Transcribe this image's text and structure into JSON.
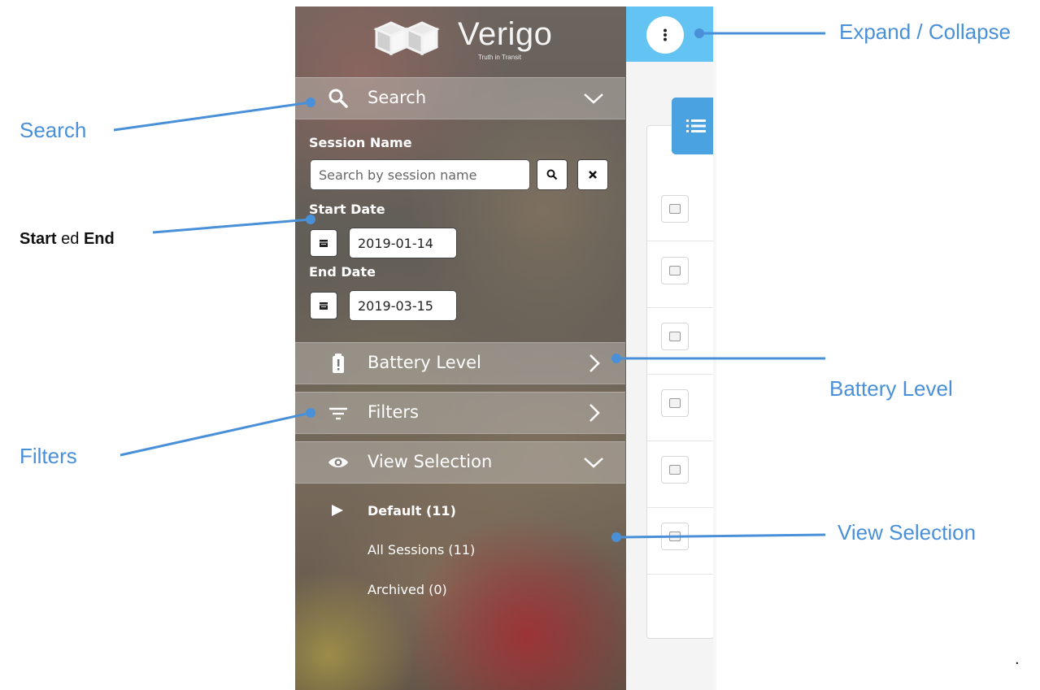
{
  "brand": {
    "name": "Verigo",
    "tagline": "Truth in Transit"
  },
  "sidebar": {
    "search_section": {
      "label": "Search"
    },
    "session_name": {
      "label": "Session Name",
      "placeholder": "Search by session name"
    },
    "start_date": {
      "label": "Start Date",
      "value": "2019-01-14"
    },
    "end_date": {
      "label": "End Date",
      "value": "2019-03-15"
    },
    "battery_section": {
      "label": "Battery Level"
    },
    "filters_section": {
      "label": "Filters"
    },
    "view_section": {
      "label": "View Selection"
    },
    "views": [
      {
        "label": "Default (11)",
        "selected": true
      },
      {
        "label": "All Sessions (11)",
        "selected": false
      },
      {
        "label": "Archived (0)",
        "selected": false
      }
    ]
  },
  "callouts": {
    "expand_collapse": "Expand / Collapse",
    "search": "Search",
    "start_end": {
      "start": "Start",
      "connector": "ed",
      "end": "End"
    },
    "battery_level": "Battery Level",
    "filters": "Filters",
    "view_selection": "View Selection",
    "trailing_mark": "."
  },
  "colors": {
    "accent": "#63c3f2",
    "callout": "#4a90d9",
    "tab": "#4aa3e0"
  }
}
